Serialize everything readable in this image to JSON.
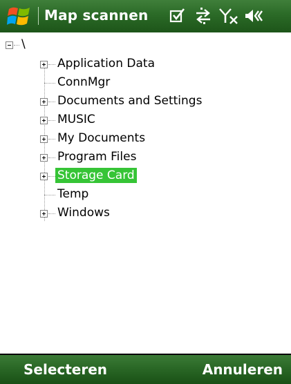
{
  "titlebar": {
    "title": "Map scannen",
    "icons": [
      "windows-start-icon",
      "checkbox-icon",
      "data-connection-icon",
      "no-signal-icon",
      "speaker-mute-icon"
    ]
  },
  "tree": {
    "root": {
      "label": "\\",
      "expanded": true
    },
    "items": [
      {
        "label": "Application Data",
        "has_children": true
      },
      {
        "label": "ConnMgr",
        "has_children": false
      },
      {
        "label": "Documents and Settings",
        "has_children": true
      },
      {
        "label": "MUSIC",
        "has_children": true
      },
      {
        "label": "My Documents",
        "has_children": true
      },
      {
        "label": "Program Files",
        "has_children": true
      },
      {
        "label": "Storage Card",
        "has_children": true,
        "selected": true
      },
      {
        "label": "Temp",
        "has_children": false
      },
      {
        "label": "Windows",
        "has_children": true
      }
    ]
  },
  "softkeys": {
    "left": "Selecteren",
    "right": "Annuleren"
  },
  "colors": {
    "titlebar": "#2b6a27",
    "selection": "#36c436",
    "softbar": "#2a6826"
  }
}
